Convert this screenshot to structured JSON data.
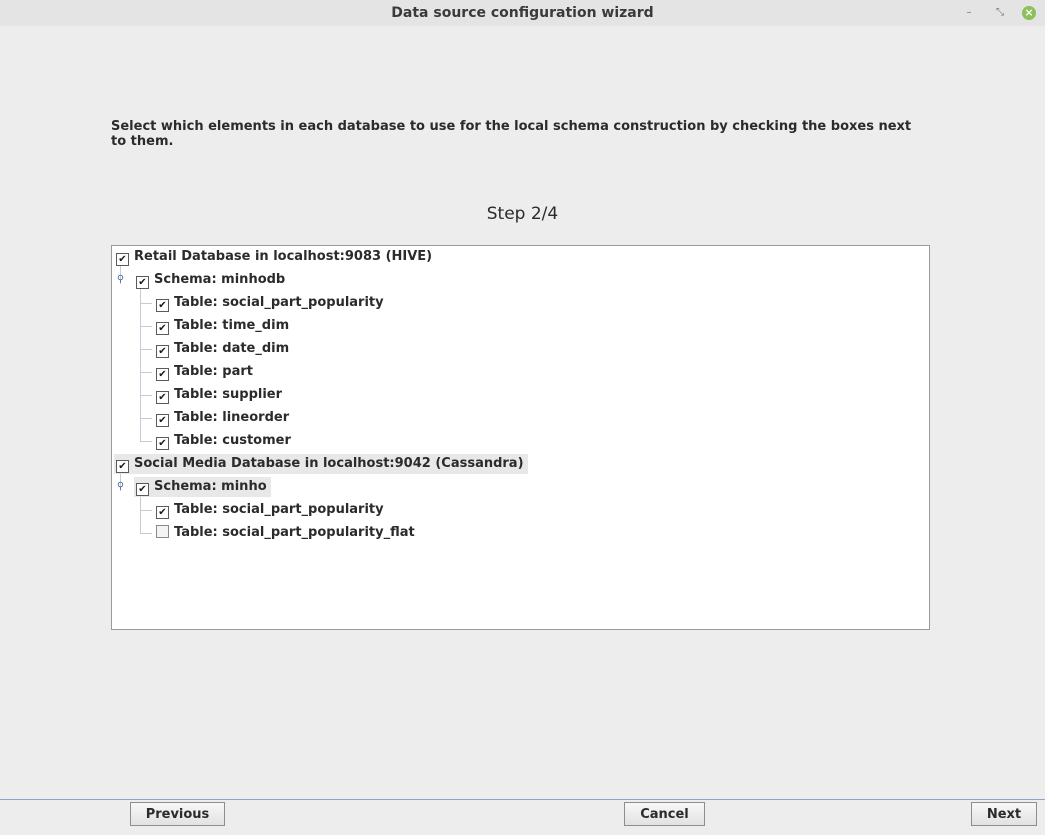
{
  "window": {
    "title": "Data source configuration wizard",
    "controls": {
      "minimize": "–",
      "maximize": "⤡",
      "close": "×"
    }
  },
  "instructions": "Select which elements in each database to use for the local schema construction by checking the boxes next to them.",
  "step_label": "Step 2/4",
  "tree": {
    "db1": {
      "label": "Retail Database in localhost:9083 (HIVE)",
      "checked": true,
      "schema": {
        "label": "Schema: minhodb",
        "checked": true,
        "tables": [
          {
            "label": "Table: social_part_popularity",
            "checked": true
          },
          {
            "label": "Table: time_dim",
            "checked": true
          },
          {
            "label": "Table: date_dim",
            "checked": true
          },
          {
            "label": "Table: part",
            "checked": true
          },
          {
            "label": "Table: supplier",
            "checked": true
          },
          {
            "label": "Table: lineorder",
            "checked": true
          },
          {
            "label": "Table: customer",
            "checked": true
          }
        ]
      }
    },
    "db2": {
      "label": "Social Media Database in localhost:9042 (Cassandra)",
      "checked": true,
      "schema": {
        "label": "Schema: minho",
        "checked": true,
        "tables": [
          {
            "label": "Table: social_part_popularity",
            "checked": true
          },
          {
            "label": "Table: social_part_popularity_flat",
            "checked": false
          }
        ]
      }
    },
    "check_glyph": "✔"
  },
  "buttons": {
    "previous": "Previous",
    "cancel": "Cancel",
    "next": "Next"
  },
  "colors": {
    "background": "#ededed",
    "panel": "#ffffff",
    "tree_line": "#c4cbd6",
    "separator": "#8fa3c8",
    "close_button": "#8dbf5a"
  }
}
